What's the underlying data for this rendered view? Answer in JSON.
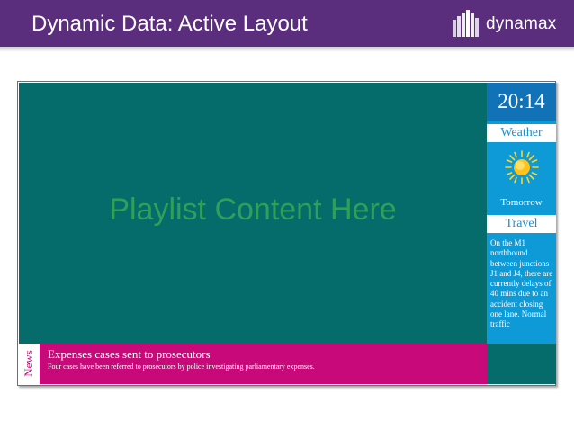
{
  "header": {
    "title": "Dynamic Data: Active Layout",
    "logo_text": "dynamax",
    "background": "#5b2d7d"
  },
  "main": {
    "playlist_text": "Playlist Content Here",
    "background": "#056c6b",
    "text_color": "#2ea05a"
  },
  "sidebar": {
    "clock": "20:14",
    "weather_label": "Weather",
    "weather_icon": "sun-icon",
    "tomorrow_label": "Tomorrow",
    "travel_label": "Travel",
    "travel_text": "On the M1 northbound between junctions J1 and J4, there are currently delays of 40 mins due to an accident closing one lane. Normal traffic",
    "background": "#0d9ad6"
  },
  "news": {
    "tab_label": "News",
    "headline": "Expenses cases sent to prosecutors",
    "body": "Four cases have been referred to prosecutors by police investigating parliamentary expenses.",
    "background": "#c8097a"
  }
}
